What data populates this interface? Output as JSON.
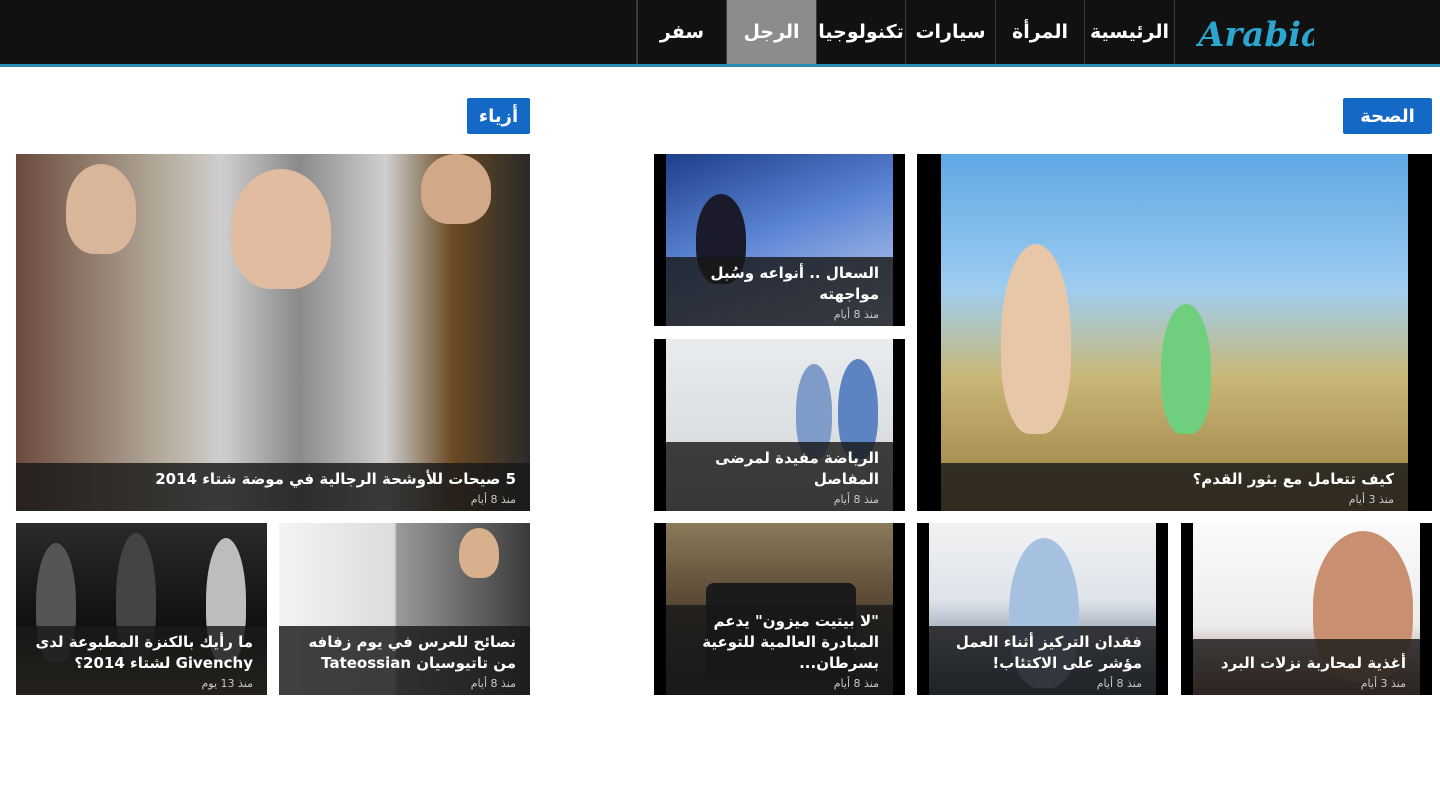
{
  "header": {
    "logo_text": "Arabia",
    "nav": [
      {
        "label": "الرئيسية",
        "active": false
      },
      {
        "label": "المرأة",
        "active": false
      },
      {
        "label": "سيارات",
        "active": false
      },
      {
        "label": "تكنولوجيا",
        "active": false
      },
      {
        "label": "الرجل",
        "active": true
      },
      {
        "label": "سفر",
        "active": false
      }
    ]
  },
  "colors": {
    "topbar": "#111111",
    "accent_line": "#2a8bb0",
    "section_label": "#1469c7",
    "active_nav": "#8c8c8c"
  },
  "sections": {
    "health": {
      "label": "الصحة",
      "articles": [
        {
          "title": "كيف تتعامل مع بثور القدم؟",
          "date": "منذ 3 أيام"
        },
        {
          "title": "السعال .. أنواعه وسُبل مواجهته",
          "date": "منذ 8 أيام"
        },
        {
          "title": "الرياضة مفيدة لمرضى المفاصل",
          "date": "منذ 8 أيام"
        },
        {
          "title": "أغذية لمحاربة نزلات البرد",
          "date": "منذ 3 أيام"
        },
        {
          "title": "فقدان التركيز أثناء العمل مؤشر على الاكتئاب!",
          "date": "منذ 8 أيام"
        },
        {
          "title": "\"لا بيتيت ميزون\" يدعم المبادرة العالمية للتوعية بسرطان...",
          "date": "منذ 8 أيام"
        }
      ]
    },
    "fashion": {
      "label": "أزياء",
      "articles": [
        {
          "title": "5 صيحات للأوشحة الرجالية في موضة شتاء 2014",
          "date": "منذ 8 أيام"
        },
        {
          "title": "نصائح للعرس في يوم زفافه من تاتيوسيان Tateossian",
          "date": "منذ 8 أيام"
        },
        {
          "title": "ما رأيك بالكنزة المطبوعة لدى Givenchy لشتاء 2014؟",
          "date": "منذ 13 يوم"
        }
      ]
    }
  }
}
